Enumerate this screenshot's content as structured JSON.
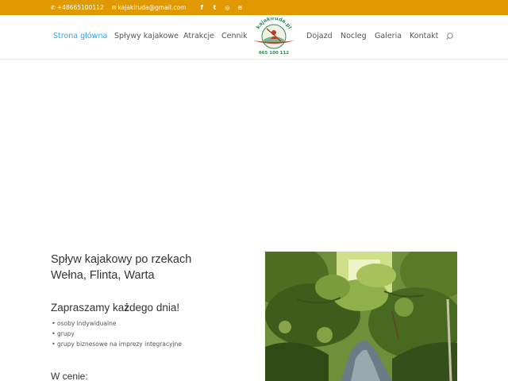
{
  "topbar": {
    "phone": "+48665100112",
    "email": "kajakiruda@gmail.com",
    "social": [
      {
        "icon": "facebook-icon",
        "glyph": "f"
      },
      {
        "icon": "twitter-icon",
        "glyph": "t"
      },
      {
        "icon": "instagram-icon",
        "glyph": "◎"
      },
      {
        "icon": "rss-icon",
        "glyph": "≋"
      }
    ]
  },
  "nav": {
    "left": [
      "Strona główna",
      "Spływy kajakowe",
      "Atrakcje",
      "Cennik"
    ],
    "right": [
      "Dojazd",
      "Nocleg",
      "Galeria",
      "Kontakt"
    ]
  },
  "logo": {
    "top_text": "kajakiruda.pl",
    "bottom_text": "665 100 112"
  },
  "content": {
    "title_line1": "Spływ kajakowy po rzekach",
    "title_line2": "Wełna, Flinta, Warta",
    "invite_pre": "Zapraszamy ka",
    "invite_bold": "ż",
    "invite_post": "dego dnia!",
    "list": [
      "osoby indywidualne",
      "grupy",
      "grupy biznesowe na imprezy integracyjne"
    ],
    "prices_heading": "W cenie:"
  },
  "colors": {
    "topbar": "#e09900",
    "nav_active": "#2ea3f2"
  }
}
